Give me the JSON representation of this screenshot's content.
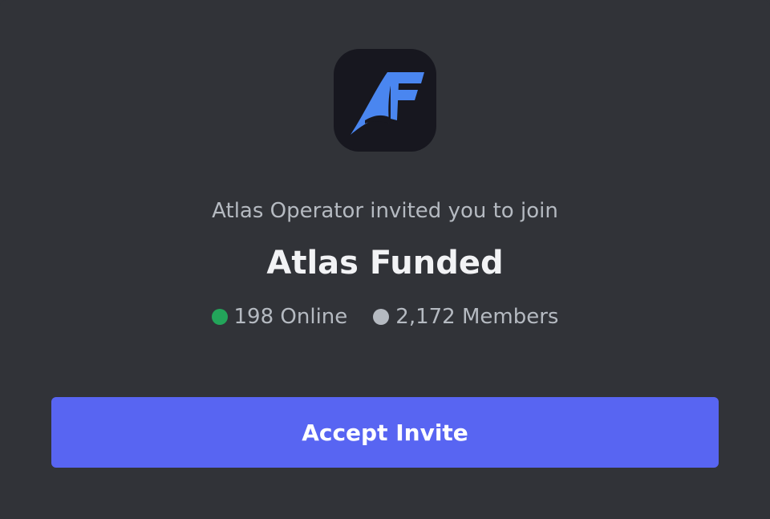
{
  "invite": {
    "inviter_line": "Atlas Operator invited you to join",
    "server_name": "Atlas Funded",
    "server_icon": {
      "name": "atlas-funded-logo",
      "logo_text": "AF",
      "accent_color": "#4a86f0",
      "background": "#17171f"
    },
    "online": {
      "label": "198 Online",
      "dot_color": "#23a55a"
    },
    "members": {
      "label": "2,172 Members",
      "dot_color": "#b5bac1"
    },
    "accept_label": "Accept Invite",
    "accept_color": "#5865f2"
  }
}
